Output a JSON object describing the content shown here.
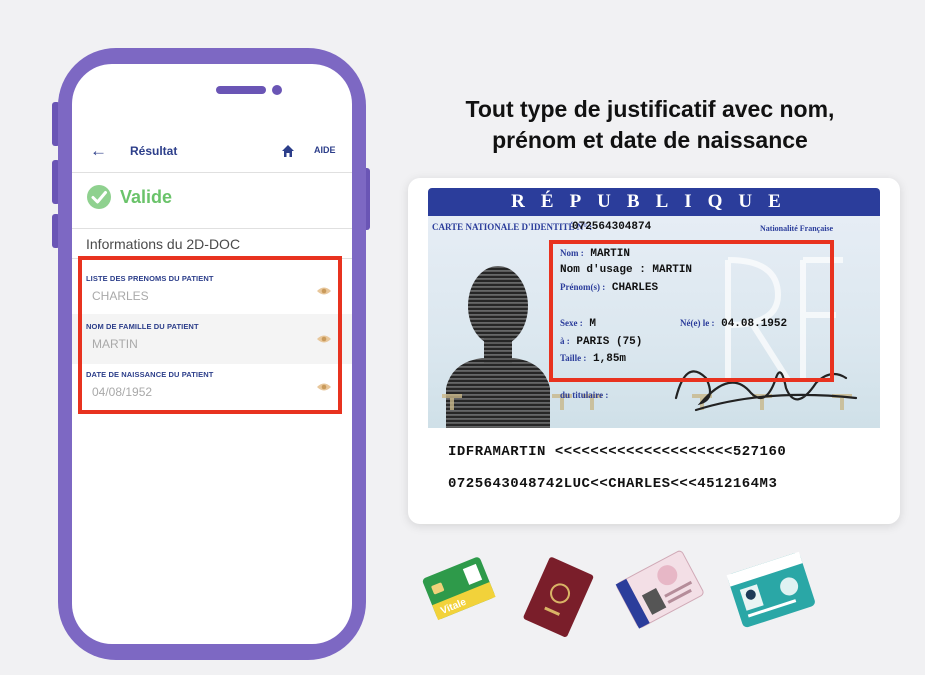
{
  "phone": {
    "appbar": {
      "title": "Résultat",
      "help_label": "AIDE"
    },
    "status": "Valide",
    "section_title": "Informations du 2D-DOC",
    "fields": [
      {
        "label": "LISTE DES PRENOMS DU PATIENT",
        "value": "CHARLES"
      },
      {
        "label": "NOM DE FAMILLE DU PATIENT",
        "value": "MARTIN"
      },
      {
        "label": "DATE DE NAISSANCE DU PATIENT",
        "value": "04/08/1952"
      }
    ]
  },
  "headline": {
    "line1": "Tout type de justificatif avec nom,",
    "line2": "prénom et date de naissance"
  },
  "id_card": {
    "country": "RÉPUBLIQUE FRANÇAISE",
    "card_label": "CARTE NATIONALE D'IDENTITÉ N° :",
    "card_number": "072564304874",
    "nationality": "Nationalité Française",
    "nom_key": "Nom :",
    "nom": "MARTIN",
    "nom_usage": "Nom d'usage : MARTIN",
    "prenoms_key": "Prénom(s) :",
    "prenoms": "CHARLES",
    "sexe_key": "Sexe :",
    "sexe": "M",
    "ne_key": "Né(e) le :",
    "ne": "04.08.1952",
    "lieu_key": "à :",
    "lieu": "PARIS (75)",
    "taille_key": "Taille :",
    "taille": "1,85m",
    "titulaire_key": "du titulaire :",
    "mrz_line1": "IDFRAMARTIN <<<<<<<<<<<<<<<<<<<<527160",
    "mrz_line2": "0725643048742LUC<<CHARLES<<<4512164M3"
  },
  "other_documents": {
    "vitale_label": "Vitale"
  },
  "colors": {
    "phone_frame": "#7d68c3",
    "highlight": "#e8321f",
    "valid_green": "#6ac36a",
    "nav_blue": "#2c3e8a",
    "card_blue": "#2b3d9b"
  }
}
